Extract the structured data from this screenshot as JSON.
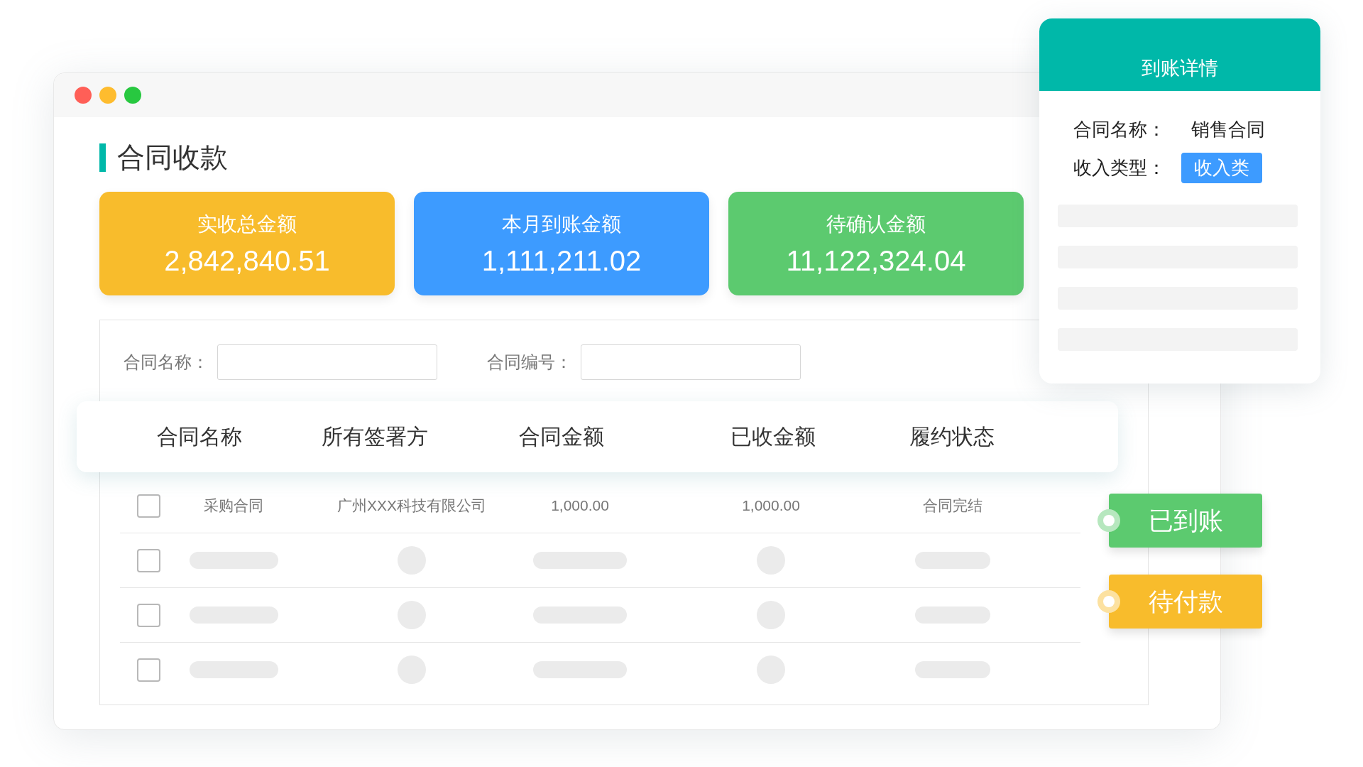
{
  "window": {
    "title": "合同收款",
    "traffic_lights": [
      {
        "color": "#ff5f57"
      },
      {
        "color": "#febc2e"
      },
      {
        "color": "#28c840"
      }
    ]
  },
  "summary_cards": [
    {
      "label": "实收总金额",
      "value": "2,842,840.51",
      "color": "#f8bc2c"
    },
    {
      "label": "本月到账金额",
      "value": "1,111,211.02",
      "color": "#3d9bff"
    },
    {
      "label": "待确认金额",
      "value": "11,122,324.04",
      "color": "#5cca6f"
    }
  ],
  "filters": [
    {
      "label": "合同名称："
    },
    {
      "label": "合同编号："
    }
  ],
  "table": {
    "columns": [
      "合同名称",
      "所有签署方",
      "合同金额",
      "已收金额",
      "履约状态"
    ],
    "rows": [
      {
        "kind": "data",
        "checked": false,
        "cells": [
          "采购合同",
          "广州XXX科技有限公司",
          "1,000.00",
          "1,000.00",
          "合同完结"
        ]
      },
      {
        "kind": "placeholder",
        "checked": false
      },
      {
        "kind": "placeholder",
        "checked": false
      },
      {
        "kind": "placeholder",
        "checked": false
      }
    ]
  },
  "status_tags": [
    {
      "label": "已到账",
      "color": "#5cca6f"
    },
    {
      "label": "待付款",
      "color": "#f8bc2c"
    }
  ],
  "detail_panel": {
    "title": "到账详情",
    "fields": [
      {
        "label": "合同名称：",
        "value": "销售合同",
        "kind": "text"
      },
      {
        "label": "收入类型：",
        "value": "收入类",
        "kind": "tag"
      }
    ],
    "blank_lines": [
      {
        "kind": "bar"
      },
      {
        "kind": "bar"
      },
      {
        "kind": "bar"
      },
      {
        "kind": "bar"
      }
    ]
  }
}
